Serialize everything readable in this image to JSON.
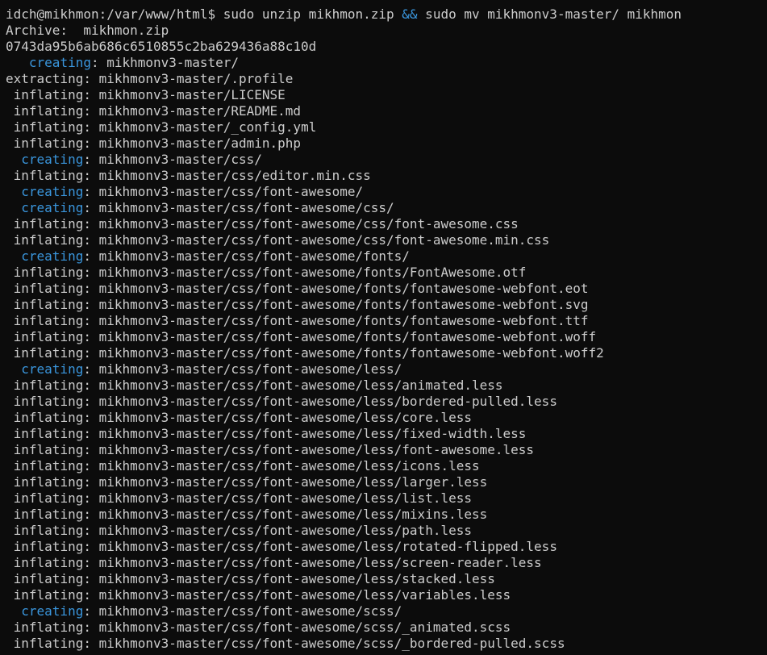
{
  "colors": {
    "background": "#0c0c0c",
    "foreground": "#cccccc",
    "accent_blue": "#3a96dd"
  },
  "prompt": {
    "user_host_path": "idch@mikhmon:/var/www/html$",
    "command_part1": " sudo unzip mikhmon.zip ",
    "operator": "&&",
    "command_part2": " sudo mv mikhmonv3-master/ mikhmon"
  },
  "archive_line": "Archive:  mikhmon.zip",
  "hash_line": "0743da95b6ab686c6510855c2ba629436a88c10d",
  "entries": [
    {
      "pad": "   ",
      "op": "creating",
      "path": "mikhmonv3-master/"
    },
    {
      "pad": "",
      "op": "extracting",
      "path": "mikhmonv3-master/.profile"
    },
    {
      "pad": " ",
      "op": "inflating",
      "path": "mikhmonv3-master/LICENSE"
    },
    {
      "pad": " ",
      "op": "inflating",
      "path": "mikhmonv3-master/README.md"
    },
    {
      "pad": " ",
      "op": "inflating",
      "path": "mikhmonv3-master/_config.yml"
    },
    {
      "pad": " ",
      "op": "inflating",
      "path": "mikhmonv3-master/admin.php"
    },
    {
      "pad": "  ",
      "op": "creating",
      "path": "mikhmonv3-master/css/"
    },
    {
      "pad": " ",
      "op": "inflating",
      "path": "mikhmonv3-master/css/editor.min.css"
    },
    {
      "pad": "  ",
      "op": "creating",
      "path": "mikhmonv3-master/css/font-awesome/"
    },
    {
      "pad": "  ",
      "op": "creating",
      "path": "mikhmonv3-master/css/font-awesome/css/"
    },
    {
      "pad": " ",
      "op": "inflating",
      "path": "mikhmonv3-master/css/font-awesome/css/font-awesome.css"
    },
    {
      "pad": " ",
      "op": "inflating",
      "path": "mikhmonv3-master/css/font-awesome/css/font-awesome.min.css"
    },
    {
      "pad": "  ",
      "op": "creating",
      "path": "mikhmonv3-master/css/font-awesome/fonts/"
    },
    {
      "pad": " ",
      "op": "inflating",
      "path": "mikhmonv3-master/css/font-awesome/fonts/FontAwesome.otf"
    },
    {
      "pad": " ",
      "op": "inflating",
      "path": "mikhmonv3-master/css/font-awesome/fonts/fontawesome-webfont.eot"
    },
    {
      "pad": " ",
      "op": "inflating",
      "path": "mikhmonv3-master/css/font-awesome/fonts/fontawesome-webfont.svg"
    },
    {
      "pad": " ",
      "op": "inflating",
      "path": "mikhmonv3-master/css/font-awesome/fonts/fontawesome-webfont.ttf"
    },
    {
      "pad": " ",
      "op": "inflating",
      "path": "mikhmonv3-master/css/font-awesome/fonts/fontawesome-webfont.woff"
    },
    {
      "pad": " ",
      "op": "inflating",
      "path": "mikhmonv3-master/css/font-awesome/fonts/fontawesome-webfont.woff2"
    },
    {
      "pad": "  ",
      "op": "creating",
      "path": "mikhmonv3-master/css/font-awesome/less/"
    },
    {
      "pad": " ",
      "op": "inflating",
      "path": "mikhmonv3-master/css/font-awesome/less/animated.less"
    },
    {
      "pad": " ",
      "op": "inflating",
      "path": "mikhmonv3-master/css/font-awesome/less/bordered-pulled.less"
    },
    {
      "pad": " ",
      "op": "inflating",
      "path": "mikhmonv3-master/css/font-awesome/less/core.less"
    },
    {
      "pad": " ",
      "op": "inflating",
      "path": "mikhmonv3-master/css/font-awesome/less/fixed-width.less"
    },
    {
      "pad": " ",
      "op": "inflating",
      "path": "mikhmonv3-master/css/font-awesome/less/font-awesome.less"
    },
    {
      "pad": " ",
      "op": "inflating",
      "path": "mikhmonv3-master/css/font-awesome/less/icons.less"
    },
    {
      "pad": " ",
      "op": "inflating",
      "path": "mikhmonv3-master/css/font-awesome/less/larger.less"
    },
    {
      "pad": " ",
      "op": "inflating",
      "path": "mikhmonv3-master/css/font-awesome/less/list.less"
    },
    {
      "pad": " ",
      "op": "inflating",
      "path": "mikhmonv3-master/css/font-awesome/less/mixins.less"
    },
    {
      "pad": " ",
      "op": "inflating",
      "path": "mikhmonv3-master/css/font-awesome/less/path.less"
    },
    {
      "pad": " ",
      "op": "inflating",
      "path": "mikhmonv3-master/css/font-awesome/less/rotated-flipped.less"
    },
    {
      "pad": " ",
      "op": "inflating",
      "path": "mikhmonv3-master/css/font-awesome/less/screen-reader.less"
    },
    {
      "pad": " ",
      "op": "inflating",
      "path": "mikhmonv3-master/css/font-awesome/less/stacked.less"
    },
    {
      "pad": " ",
      "op": "inflating",
      "path": "mikhmonv3-master/css/font-awesome/less/variables.less"
    },
    {
      "pad": "  ",
      "op": "creating",
      "path": "mikhmonv3-master/css/font-awesome/scss/"
    },
    {
      "pad": " ",
      "op": "inflating",
      "path": "mikhmonv3-master/css/font-awesome/scss/_animated.scss"
    },
    {
      "pad": " ",
      "op": "inflating",
      "path": "mikhmonv3-master/css/font-awesome/scss/_bordered-pulled.scss"
    }
  ]
}
